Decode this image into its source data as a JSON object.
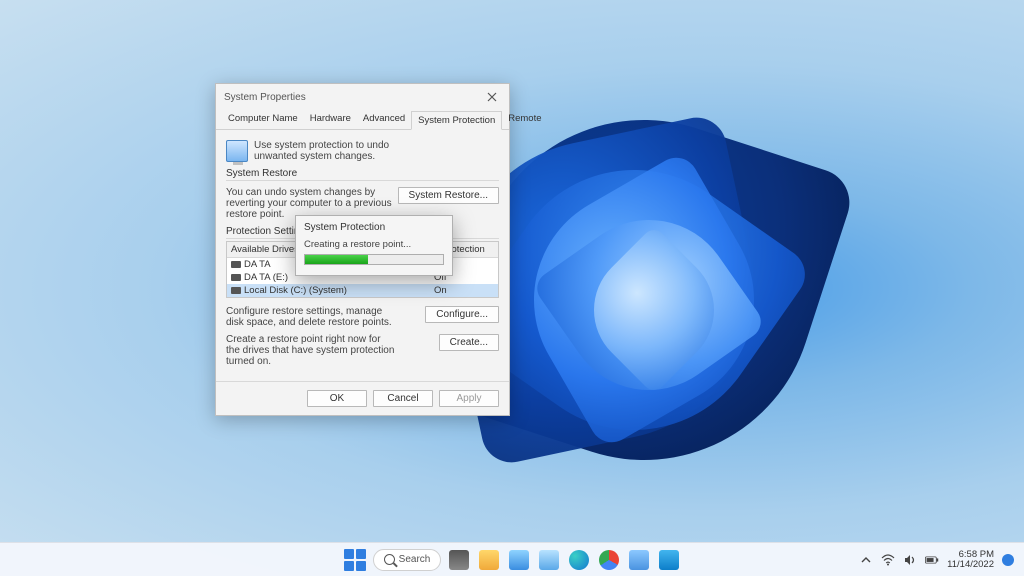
{
  "dialog": {
    "title": "System Properties",
    "tabs": [
      "Computer Name",
      "Hardware",
      "Advanced",
      "System Protection",
      "Remote"
    ],
    "active_tab": "System Protection",
    "intro": "Use system protection to undo unwanted system changes.",
    "sections": {
      "restore": {
        "title": "System Restore",
        "text": "You can undo system changes by reverting your computer to a previous restore point.",
        "button": "System Restore..."
      },
      "settings": {
        "title": "Protection Settings",
        "header_drive": "Available Drives",
        "header_status": "Protection",
        "drives": [
          {
            "name": "DA TA",
            "status": ""
          },
          {
            "name": "DA TA (E:)",
            "status": "Off"
          },
          {
            "name": "Local Disk (C:) (System)",
            "status": "On",
            "selected": true
          }
        ],
        "configure_text": "Configure restore settings, manage disk space, and delete restore points.",
        "configure_button": "Configure...",
        "create_text": "Create a restore point right now for the drives that have system protection turned on.",
        "create_button": "Create..."
      }
    },
    "buttons": {
      "ok": "OK",
      "cancel": "Cancel",
      "apply": "Apply"
    }
  },
  "progress": {
    "title": "System Protection",
    "message": "Creating a restore point...",
    "percent": 46
  },
  "taskbar": {
    "search_label": "Search",
    "time": "6:58 PM",
    "date": "11/14/2022"
  }
}
